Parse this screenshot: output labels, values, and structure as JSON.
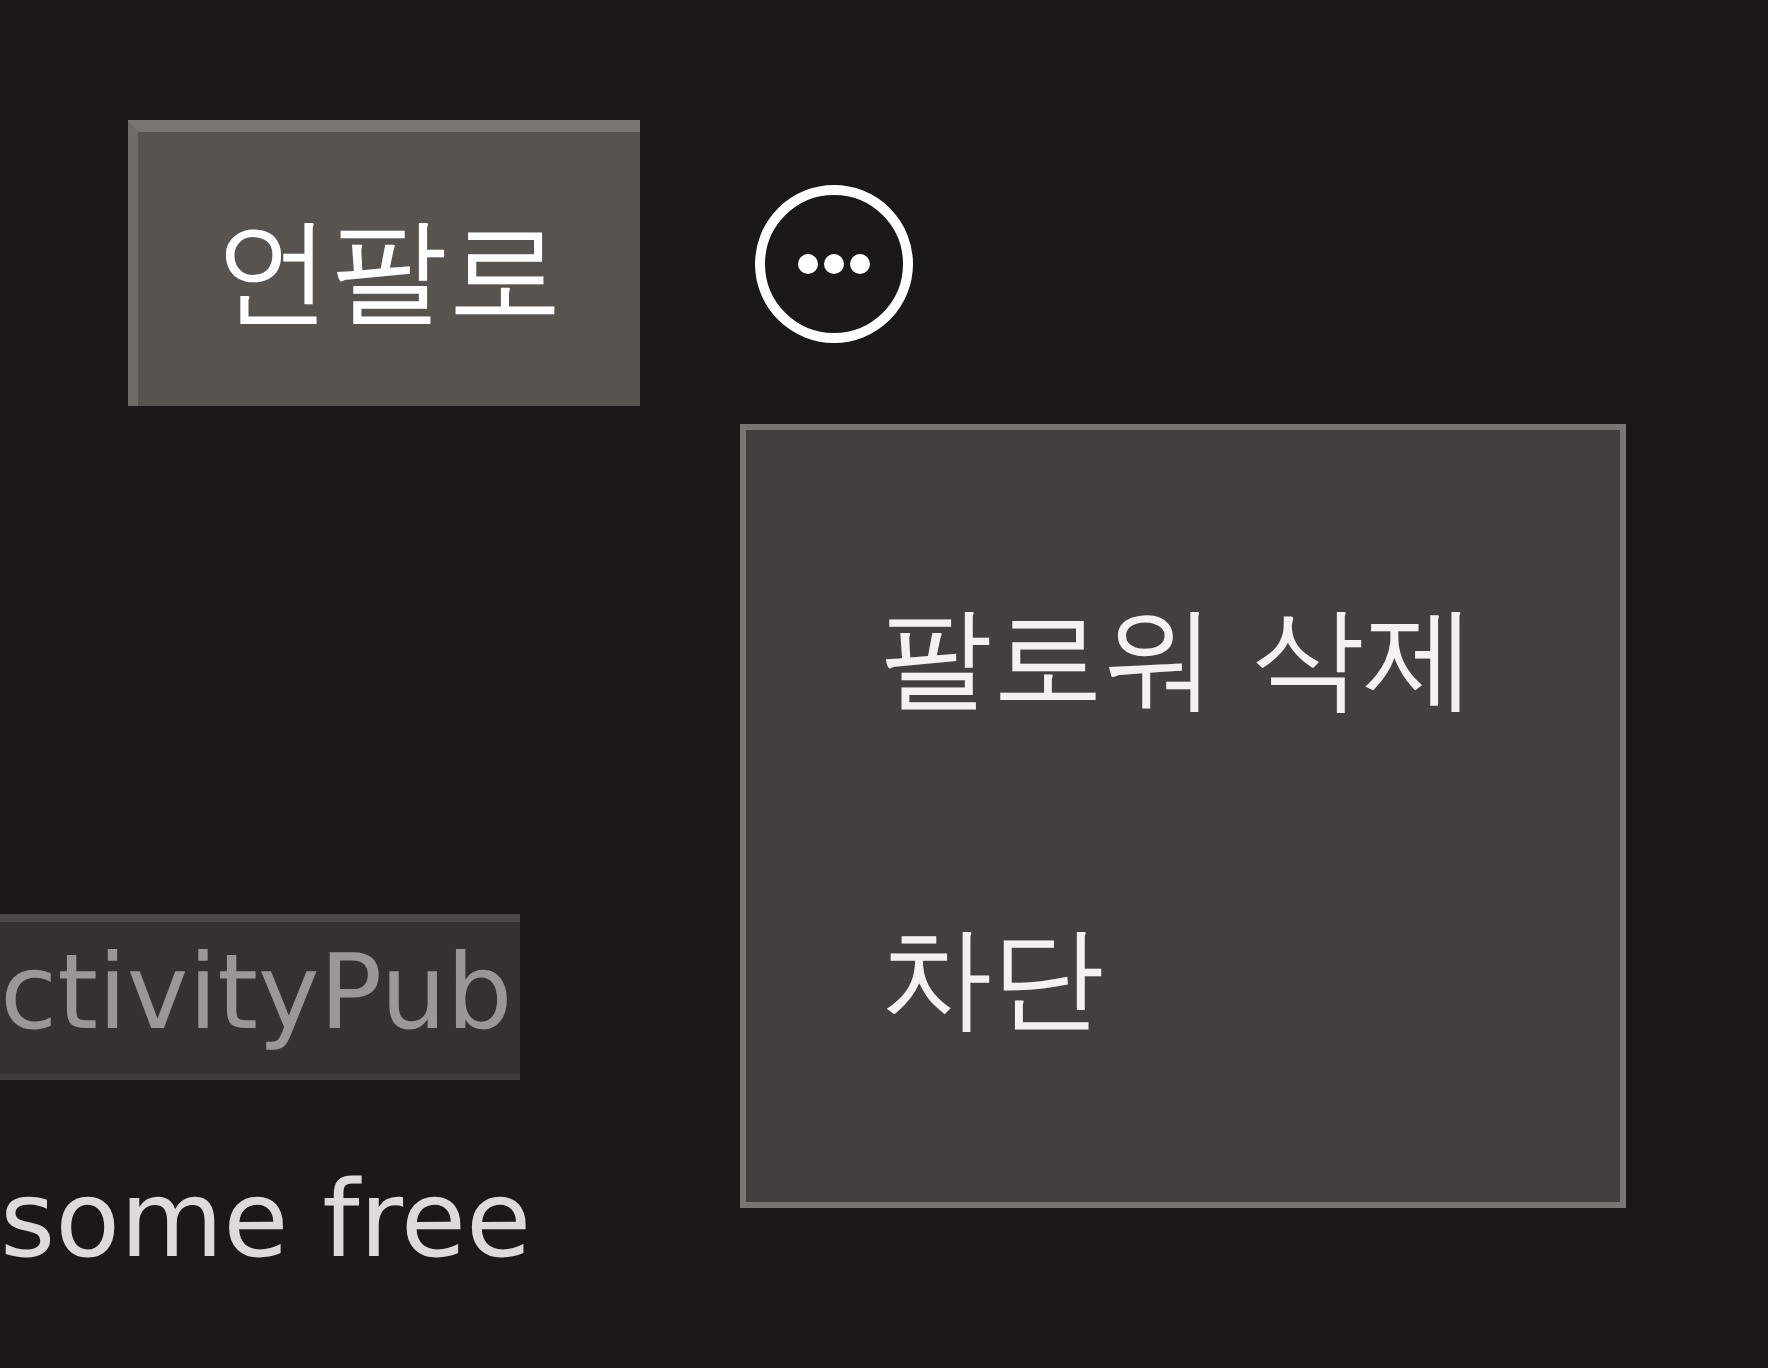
{
  "profile_actions": {
    "unfollow_button": {
      "label": "언팔로"
    }
  },
  "more_menu": {
    "open": true,
    "items": [
      {
        "label": "팔로워 삭제"
      },
      {
        "label": "차단"
      }
    ]
  },
  "bio": {
    "tag": "ctivityPub",
    "text": "some free"
  }
}
